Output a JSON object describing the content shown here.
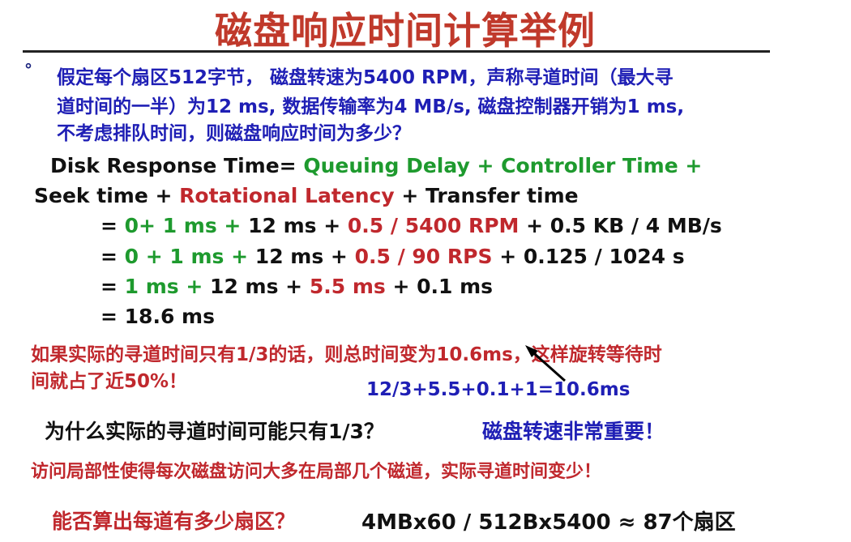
{
  "title": "磁盘响应时间计算举例",
  "bullet_symbol": "°",
  "question": {
    "line1": "假定每个扇区512字节， 磁盘转速为5400 RPM，声称寻道时间（最大寻",
    "line2": "道时间的一半）为12 ms, 数据传输率为4 MB/s, 磁盘控制器开销为1 ms,",
    "line3": "不考虑排队时间，则磁盘响应时间为多少？"
  },
  "formula": {
    "line1": {
      "a": "Disk Response Time= ",
      "b": "Queuing Delay",
      "c": "  + ",
      "d": "Controller Time +"
    },
    "line2": {
      "a": "Seek time  +  ",
      "b": "Rotational Latency",
      "c": "  + Transfer time"
    },
    "line3": {
      "a": "= ",
      "b": "0+ 1 ms +",
      "c": " 12 ms + ",
      "d": "0.5 / 5400 RPM",
      "e": " + 0.5 KB / 4 MB/s"
    },
    "line4": {
      "a": "= ",
      "b": "0 + 1 ms +",
      "c": " 12  ms +  ",
      "d": "0.5 / 90 RPS",
      "e": " + 0.125 / 1024 s"
    },
    "line5": {
      "a": "=  ",
      "b": "1 ms +",
      "c": "  12 ms +  ",
      "d": "5.5 ms",
      "e": " + 0.1 ms"
    },
    "line6": "= 18.6 ms"
  },
  "note": {
    "line1": "如果实际的寻道时间只有1/3的话，则总时间变为10.6ms，这样旋转等待时",
    "line2": "间就占了近50%！",
    "calc": "12/3+5.5+0.1+1=10.6ms"
  },
  "why": {
    "question": "为什么实际的寻道时间可能只有1/3？",
    "answer": "磁盘转速非常重要！"
  },
  "locality": "访问局部性使得每次磁盘访问大多在局部几个磁道，实际寻道时间变少！",
  "sectors": {
    "question": "能否算出每道有多少扇区？",
    "answer": "4MBx60 / 512Bx5400 ≈ 87个扇区"
  },
  "colors": {
    "title": "#c0392b",
    "question": "#1f1fb5",
    "green": "#1e9a2e",
    "red": "#c0282d",
    "text": "#111111"
  }
}
